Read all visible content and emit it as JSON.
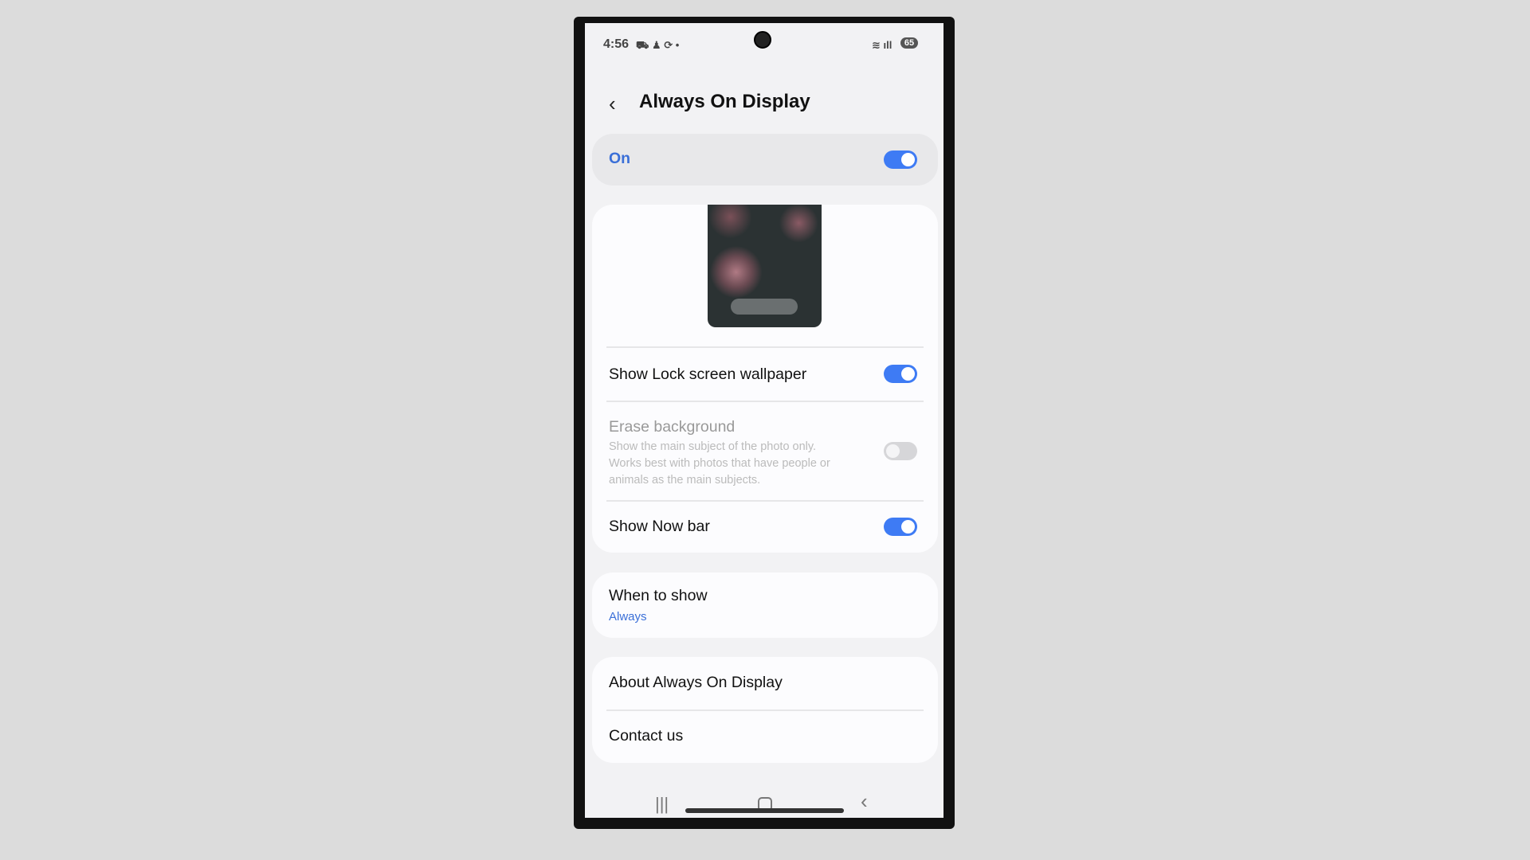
{
  "status_bar": {
    "time": "4:56",
    "notif_icons": [
      "carrier-icon",
      "person-icon",
      "sync-icon"
    ],
    "battery": "65"
  },
  "header": {
    "title": "Always On Display"
  },
  "master": {
    "label": "On",
    "enabled": true
  },
  "settings": [
    {
      "label": "Show Lock screen wallpaper",
      "enabled": true
    },
    {
      "label": "Erase background",
      "description": [
        "Show the main subject of the photo only.",
        "Works best with photos that have people or",
        "animals as the main subjects."
      ],
      "enabled": false,
      "disabled": true
    },
    {
      "label": "Show Now bar",
      "enabled": true
    }
  ],
  "when_to_show": {
    "label": "When to show",
    "value": "Always"
  },
  "links": {
    "about": "About Always On Display",
    "contact": "Contact us"
  },
  "colors": {
    "accent": "#3e7bf4",
    "background": "#f2f2f4"
  }
}
